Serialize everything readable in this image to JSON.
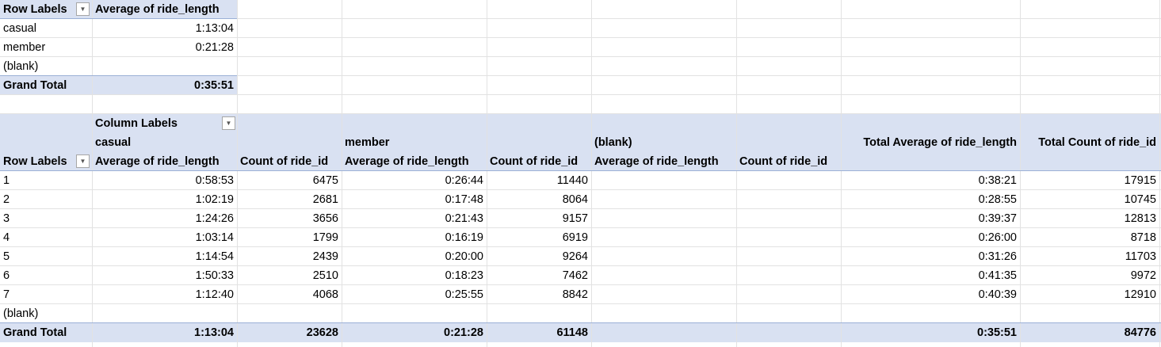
{
  "pivot1": {
    "header": {
      "row_labels": "Row Labels",
      "value_col": "Average of ride_length"
    },
    "rows": [
      {
        "label": "casual",
        "value": "1:13:04"
      },
      {
        "label": "member",
        "value": "0:21:28"
      },
      {
        "label": "(blank)",
        "value": ""
      }
    ],
    "grand_total": {
      "label": "Grand Total",
      "value": "0:35:51"
    }
  },
  "pivot2": {
    "column_labels": "Column Labels",
    "groups": {
      "casual": "casual",
      "member": "member",
      "blank": "(blank)"
    },
    "total_avg_header": "Total Average of ride_length",
    "total_count_header": "Total Count of ride_id",
    "row_labels": "Row Labels",
    "avg_header": "Average of ride_length",
    "count_header": "Count of ride_id",
    "rows": [
      {
        "label": "1",
        "c_avg": "0:58:53",
        "c_cnt": "6475",
        "m_avg": "0:26:44",
        "m_cnt": "11440",
        "t_avg": "0:38:21",
        "t_cnt": "17915"
      },
      {
        "label": "2",
        "c_avg": "1:02:19",
        "c_cnt": "2681",
        "m_avg": "0:17:48",
        "m_cnt": "8064",
        "t_avg": "0:28:55",
        "t_cnt": "10745"
      },
      {
        "label": "3",
        "c_avg": "1:24:26",
        "c_cnt": "3656",
        "m_avg": "0:21:43",
        "m_cnt": "9157",
        "t_avg": "0:39:37",
        "t_cnt": "12813"
      },
      {
        "label": "4",
        "c_avg": "1:03:14",
        "c_cnt": "1799",
        "m_avg": "0:16:19",
        "m_cnt": "6919",
        "t_avg": "0:26:00",
        "t_cnt": "8718"
      },
      {
        "label": "5",
        "c_avg": "1:14:54",
        "c_cnt": "2439",
        "m_avg": "0:20:00",
        "m_cnt": "9264",
        "t_avg": "0:31:26",
        "t_cnt": "11703"
      },
      {
        "label": "6",
        "c_avg": "1:50:33",
        "c_cnt": "2510",
        "m_avg": "0:18:23",
        "m_cnt": "7462",
        "t_avg": "0:41:35",
        "t_cnt": "9972"
      },
      {
        "label": "7",
        "c_avg": "1:12:40",
        "c_cnt": "4068",
        "m_avg": "0:25:55",
        "m_cnt": "8842",
        "t_avg": "0:40:39",
        "t_cnt": "12910"
      },
      {
        "label": "(blank)",
        "c_avg": "",
        "c_cnt": "",
        "m_avg": "",
        "m_cnt": "",
        "t_avg": "",
        "t_cnt": ""
      }
    ],
    "grand_total": {
      "label": "Grand Total",
      "c_avg": "1:13:04",
      "c_cnt": "23628",
      "m_avg": "0:21:28",
      "m_cnt": "61148",
      "t_avg": "0:35:51",
      "t_cnt": "84776"
    }
  },
  "icons": {
    "filter_dropdown": "dropdown-arrow-icon"
  },
  "colors": {
    "pivot_header_bg": "#d9e1f2",
    "pivot_border": "#9bb0d6",
    "gridline": "#e2e2e2"
  }
}
